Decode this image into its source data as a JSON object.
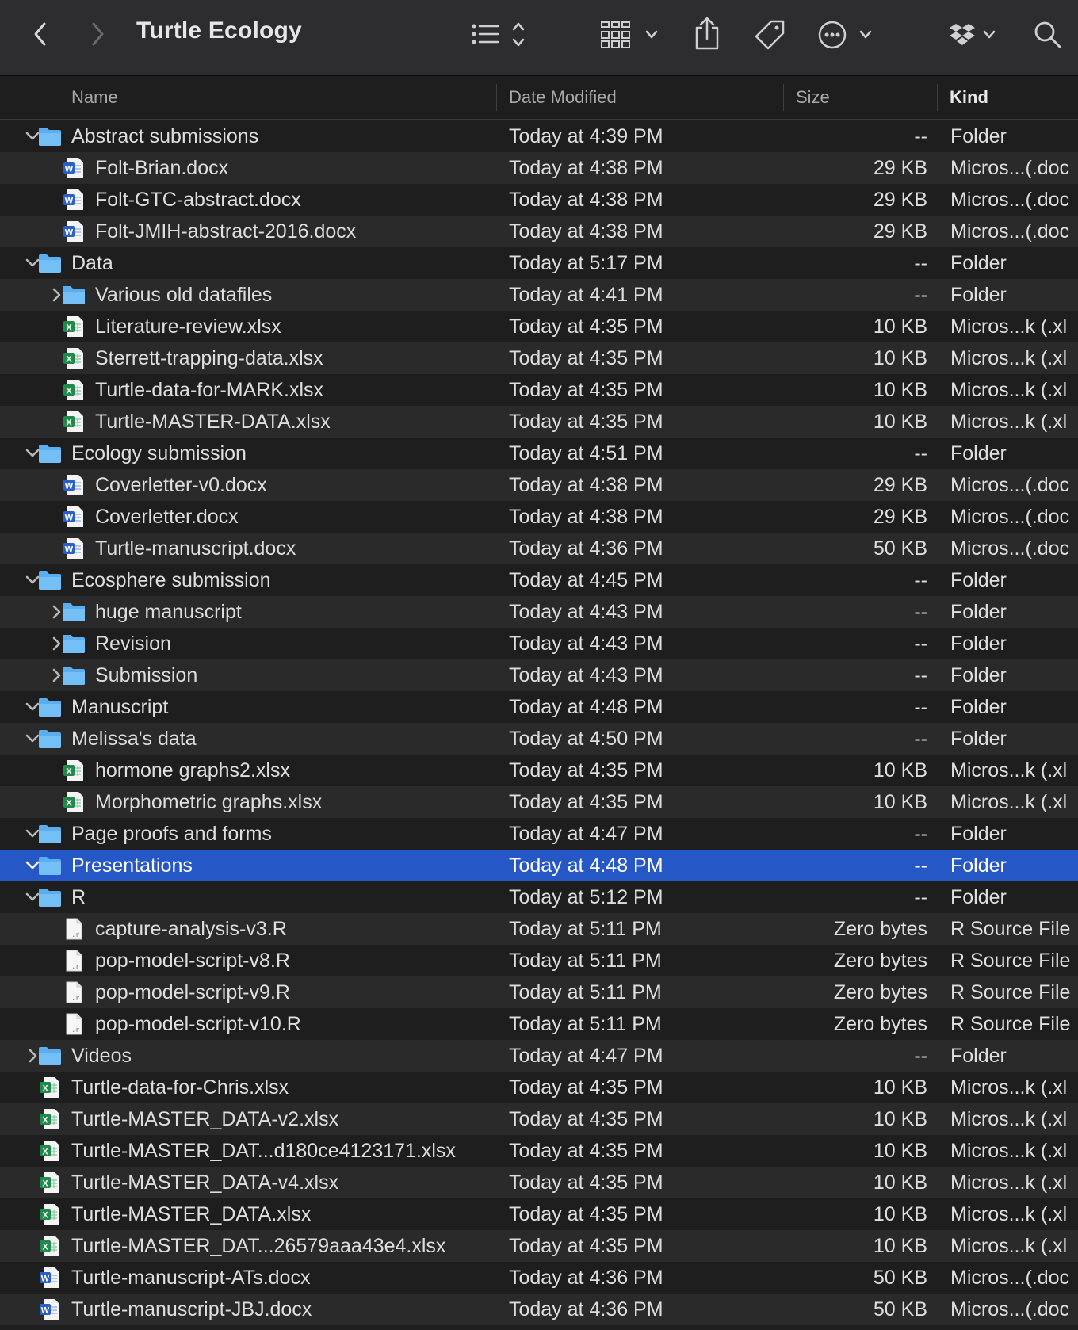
{
  "window": {
    "title": "Turtle Ecology"
  },
  "toolbar": {
    "icons": [
      "back-icon",
      "forward-icon",
      "list-view-icon",
      "group-icon",
      "share-icon",
      "tag-icon",
      "more-icon",
      "dropbox-icon",
      "search-icon"
    ]
  },
  "columns": {
    "name": "Name",
    "date": "Date Modified",
    "size": "Size",
    "kind": "Kind"
  },
  "rows": [
    {
      "level": 0,
      "type": "folder",
      "disclosure": "open",
      "name": "Abstract submissions",
      "date": "Today at 4:39 PM",
      "size": "--",
      "kind": "Folder"
    },
    {
      "level": 1,
      "type": "docx",
      "disclosure": "none",
      "name": "Folt-Brian.docx",
      "date": "Today at 4:38 PM",
      "size": "29 KB",
      "kind": "Micros...(.doc"
    },
    {
      "level": 1,
      "type": "docx",
      "disclosure": "none",
      "name": "Folt-GTC-abstract.docx",
      "date": "Today at 4:38 PM",
      "size": "29 KB",
      "kind": "Micros...(.doc"
    },
    {
      "level": 1,
      "type": "docx",
      "disclosure": "none",
      "name": "Folt-JMIH-abstract-2016.docx",
      "date": "Today at 4:38 PM",
      "size": "29 KB",
      "kind": "Micros...(.doc"
    },
    {
      "level": 0,
      "type": "folder",
      "disclosure": "open",
      "name": "Data",
      "date": "Today at 5:17 PM",
      "size": "--",
      "kind": "Folder"
    },
    {
      "level": 1,
      "type": "folder",
      "disclosure": "closed",
      "name": "Various old datafiles",
      "date": "Today at 4:41 PM",
      "size": "--",
      "kind": "Folder"
    },
    {
      "level": 1,
      "type": "xlsx",
      "disclosure": "none",
      "name": "Literature-review.xlsx",
      "date": "Today at 4:35 PM",
      "size": "10 KB",
      "kind": "Micros...k (.xl"
    },
    {
      "level": 1,
      "type": "xlsx",
      "disclosure": "none",
      "name": "Sterrett-trapping-data.xlsx",
      "date": "Today at 4:35 PM",
      "size": "10 KB",
      "kind": "Micros...k (.xl"
    },
    {
      "level": 1,
      "type": "xlsx",
      "disclosure": "none",
      "name": "Turtle-data-for-MARK.xlsx",
      "date": "Today at 4:35 PM",
      "size": "10 KB",
      "kind": "Micros...k (.xl"
    },
    {
      "level": 1,
      "type": "xlsx",
      "disclosure": "none",
      "name": "Turtle-MASTER-DATA.xlsx",
      "date": "Today at 4:35 PM",
      "size": "10 KB",
      "kind": "Micros...k (.xl"
    },
    {
      "level": 0,
      "type": "folder",
      "disclosure": "open",
      "name": "Ecology submission",
      "date": "Today at 4:51 PM",
      "size": "--",
      "kind": "Folder"
    },
    {
      "level": 1,
      "type": "docx",
      "disclosure": "none",
      "name": "Coverletter-v0.docx",
      "date": "Today at 4:38 PM",
      "size": "29 KB",
      "kind": "Micros...(.doc"
    },
    {
      "level": 1,
      "type": "docx",
      "disclosure": "none",
      "name": "Coverletter.docx",
      "date": "Today at 4:38 PM",
      "size": "29 KB",
      "kind": "Micros...(.doc"
    },
    {
      "level": 1,
      "type": "docx",
      "disclosure": "none",
      "name": "Turtle-manuscript.docx",
      "date": "Today at 4:36 PM",
      "size": "50 KB",
      "kind": "Micros...(.doc"
    },
    {
      "level": 0,
      "type": "folder",
      "disclosure": "open",
      "name": "Ecosphere submission",
      "date": "Today at 4:45 PM",
      "size": "--",
      "kind": "Folder"
    },
    {
      "level": 1,
      "type": "folder",
      "disclosure": "closed",
      "name": "huge manuscript",
      "date": "Today at 4:43 PM",
      "size": "--",
      "kind": "Folder"
    },
    {
      "level": 1,
      "type": "folder",
      "disclosure": "closed",
      "name": "Revision",
      "date": "Today at 4:43 PM",
      "size": "--",
      "kind": "Folder"
    },
    {
      "level": 1,
      "type": "folder",
      "disclosure": "closed",
      "name": "Submission",
      "date": "Today at 4:43 PM",
      "size": "--",
      "kind": "Folder"
    },
    {
      "level": 0,
      "type": "folder",
      "disclosure": "open",
      "name": "Manuscript",
      "date": "Today at 4:48 PM",
      "size": "--",
      "kind": "Folder"
    },
    {
      "level": 0,
      "type": "folder",
      "disclosure": "open",
      "name": "Melissa's data",
      "date": "Today at 4:50 PM",
      "size": "--",
      "kind": "Folder"
    },
    {
      "level": 1,
      "type": "xlsx",
      "disclosure": "none",
      "name": "hormone graphs2.xlsx",
      "date": "Today at 4:35 PM",
      "size": "10 KB",
      "kind": "Micros...k (.xl"
    },
    {
      "level": 1,
      "type": "xlsx",
      "disclosure": "none",
      "name": "Morphometric graphs.xlsx",
      "date": "Today at 4:35 PM",
      "size": "10 KB",
      "kind": "Micros...k (.xl"
    },
    {
      "level": 0,
      "type": "folder",
      "disclosure": "open",
      "name": "Page proofs and forms",
      "date": "Today at 4:47 PM",
      "size": "--",
      "kind": "Folder"
    },
    {
      "level": 0,
      "type": "folder",
      "disclosure": "open",
      "name": "Presentations",
      "date": "Today at 4:48 PM",
      "size": "--",
      "kind": "Folder",
      "selected": true
    },
    {
      "level": 0,
      "type": "folder",
      "disclosure": "open",
      "name": "R",
      "date": "Today at 5:12 PM",
      "size": "--",
      "kind": "Folder"
    },
    {
      "level": 1,
      "type": "r",
      "disclosure": "none",
      "name": "capture-analysis-v3.R",
      "date": "Today at 5:11 PM",
      "size": "Zero bytes",
      "kind": "R Source File"
    },
    {
      "level": 1,
      "type": "r",
      "disclosure": "none",
      "name": "pop-model-script-v8.R",
      "date": "Today at 5:11 PM",
      "size": "Zero bytes",
      "kind": "R Source File"
    },
    {
      "level": 1,
      "type": "r",
      "disclosure": "none",
      "name": "pop-model-script-v9.R",
      "date": "Today at 5:11 PM",
      "size": "Zero bytes",
      "kind": "R Source File"
    },
    {
      "level": 1,
      "type": "r",
      "disclosure": "none",
      "name": "pop-model-script-v10.R",
      "date": "Today at 5:11 PM",
      "size": "Zero bytes",
      "kind": "R Source File"
    },
    {
      "level": 0,
      "type": "folder",
      "disclosure": "closed",
      "name": "Videos",
      "date": "Today at 4:47 PM",
      "size": "--",
      "kind": "Folder"
    },
    {
      "level": 0,
      "type": "xlsx",
      "disclosure": "none",
      "name": "Turtle-data-for-Chris.xlsx",
      "date": "Today at 4:35 PM",
      "size": "10 KB",
      "kind": "Micros...k (.xl"
    },
    {
      "level": 0,
      "type": "xlsx",
      "disclosure": "none",
      "name": "Turtle-MASTER_DATA-v2.xlsx",
      "date": "Today at 4:35 PM",
      "size": "10 KB",
      "kind": "Micros...k (.xl"
    },
    {
      "level": 0,
      "type": "xlsx",
      "disclosure": "none",
      "name": "Turtle-MASTER_DAT...d180ce4123171.xlsx",
      "date": "Today at 4:35 PM",
      "size": "10 KB",
      "kind": "Micros...k (.xl"
    },
    {
      "level": 0,
      "type": "xlsx",
      "disclosure": "none",
      "name": "Turtle-MASTER_DATA-v4.xlsx",
      "date": "Today at 4:35 PM",
      "size": "10 KB",
      "kind": "Micros...k (.xl"
    },
    {
      "level": 0,
      "type": "xlsx",
      "disclosure": "none",
      "name": "Turtle-MASTER_DATA.xlsx",
      "date": "Today at 4:35 PM",
      "size": "10 KB",
      "kind": "Micros...k (.xl"
    },
    {
      "level": 0,
      "type": "xlsx",
      "disclosure": "none",
      "name": "Turtle-MASTER_DAT...26579aaa43e4.xlsx",
      "date": "Today at 4:35 PM",
      "size": "10 KB",
      "kind": "Micros...k (.xl"
    },
    {
      "level": 0,
      "type": "docx",
      "disclosure": "none",
      "name": "Turtle-manuscript-ATs.docx",
      "date": "Today at 4:36 PM",
      "size": "50 KB",
      "kind": "Micros...(.doc"
    },
    {
      "level": 0,
      "type": "docx",
      "disclosure": "none",
      "name": "Turtle-manuscript-JBJ.docx",
      "date": "Today at 4:36 PM",
      "size": "50 KB",
      "kind": "Micros...(.doc"
    }
  ],
  "colors": {
    "selection": "#2657c6",
    "folder": "#5aaef0",
    "word": "#2b5fc7",
    "excel": "#1f8a4a"
  }
}
